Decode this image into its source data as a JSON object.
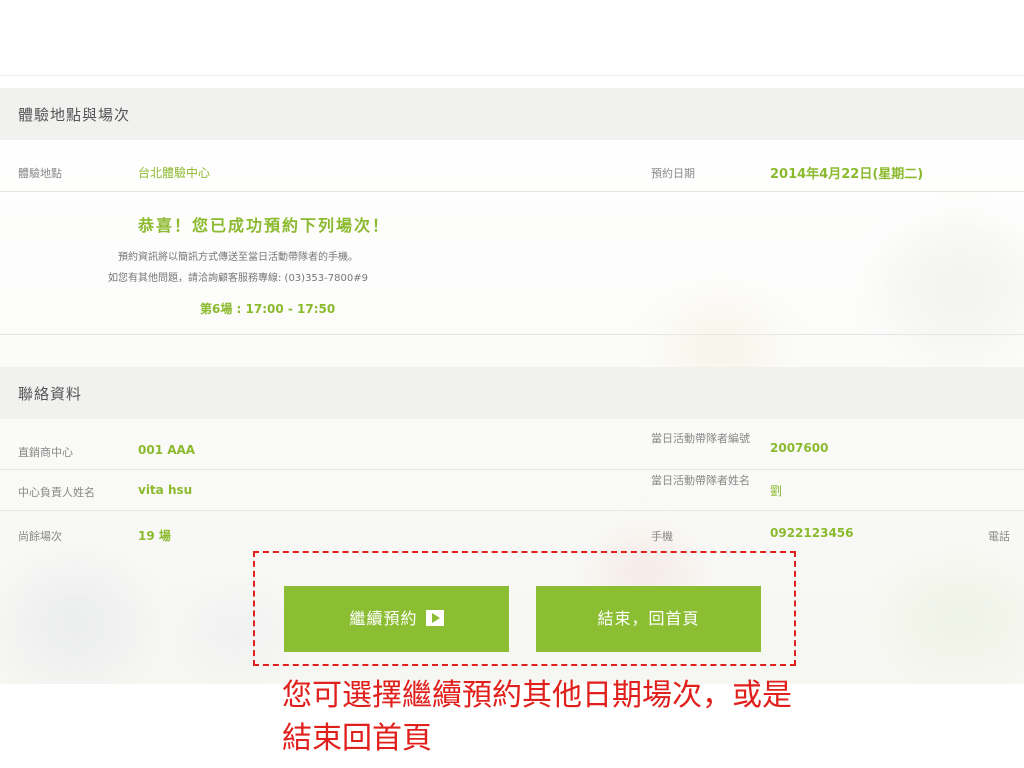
{
  "location_section": {
    "title": "體驗地點與場次",
    "location_label": "體驗地點",
    "location_value": "台北體驗中心",
    "date_label": "預約日期",
    "date_value": "2014年4月22日(星期二)"
  },
  "success": {
    "title": "恭喜！您已成功預約下列場次！",
    "line1": "預約資訊將以簡訊方式傳送至當日活動帶隊者的手機。",
    "line2": "如您有其他問題，請洽詢顧客服務專線: (03)353-7800#9",
    "session": "第6場 : 17:00 - 17:50"
  },
  "contact_section": {
    "title": "聯絡資料",
    "rows": [
      {
        "label": "直銷商中心",
        "value": "001 AAA",
        "right_label": "當日活動帶隊者編號",
        "right_value": "2007600"
      },
      {
        "label": "中心負責人姓名",
        "value": "vita hsu",
        "right_label": "當日活動帶隊者姓名",
        "right_value": "劉"
      },
      {
        "label": "尚餘場次",
        "value": "19 場",
        "right_label": "手機",
        "right_value": "0922123456",
        "far_right_label": "電話"
      }
    ]
  },
  "buttons": {
    "continue_label": "繼續預約",
    "end_label": "結束，回首頁"
  },
  "annotation": {
    "text": "您可選擇繼續預約其他日期場次，或是結束回首頁"
  },
  "colors": {
    "accent_green": "#8cbe34",
    "annotation_red": "#e0201c"
  }
}
